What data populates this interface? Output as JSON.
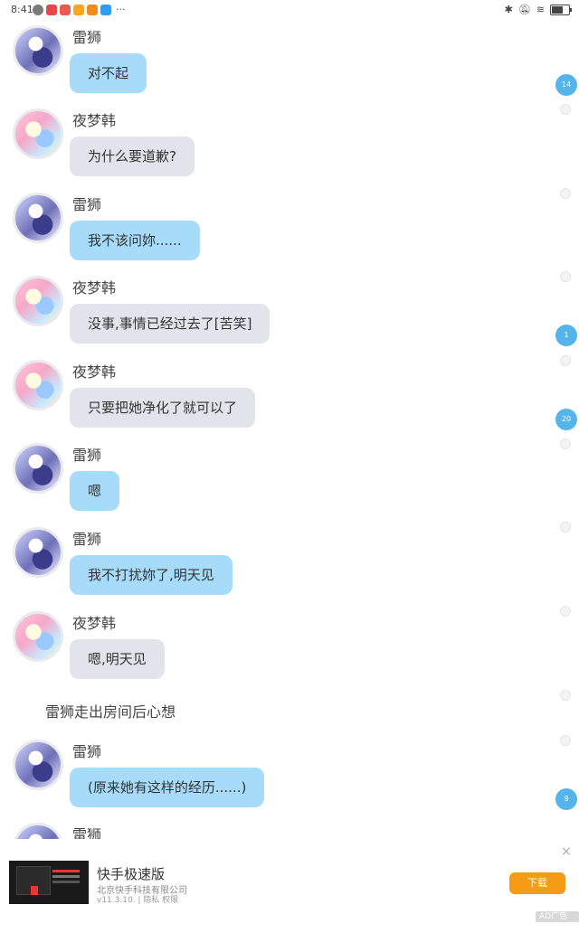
{
  "status_bar": {
    "time": "8:41",
    "overflow": "···",
    "apps": [
      {
        "name": "wechat-icon",
        "color": "#7a7a7a"
      },
      {
        "name": "red-app-icon",
        "color": "#e5484d"
      },
      {
        "name": "red-app-icon-2",
        "color": "#e85a4f"
      },
      {
        "name": "orange-app-icon",
        "color": "#f5a623"
      },
      {
        "name": "orange-app-icon-2",
        "color": "#f08c24"
      },
      {
        "name": "blue-app-icon",
        "color": "#2f9cf0"
      }
    ],
    "right_icons": [
      "bluetooth-icon",
      "mute-icon",
      "wifi-icon",
      "battery-icon"
    ]
  },
  "messages": [
    {
      "speaker": "雷狮",
      "text": "对不起",
      "style": "blue",
      "avatar": "leishi"
    },
    {
      "speaker": "夜梦韩",
      "text": "为什么要道歉?",
      "style": "grey",
      "avatar": "yemeng"
    },
    {
      "speaker": "雷狮",
      "text": "我不该问妳......",
      "style": "blue",
      "avatar": "leishi"
    },
    {
      "speaker": "夜梦韩",
      "text": "没事,事情已经过去了[苦笑]",
      "style": "grey",
      "avatar": "yemeng"
    },
    {
      "speaker": "夜梦韩",
      "text": "只要把她净化了就可以了",
      "style": "grey",
      "avatar": "yemeng"
    },
    {
      "speaker": "雷狮",
      "text": "嗯",
      "style": "blue",
      "avatar": "leishi"
    },
    {
      "speaker": "雷狮",
      "text": "我不打扰妳了,明天见",
      "style": "blue",
      "avatar": "leishi"
    },
    {
      "speaker": "夜梦韩",
      "text": "嗯,明天见",
      "style": "grey",
      "avatar": "yemeng"
    },
    {
      "speaker": "雷狮",
      "text": "(原来她有这样的经历......)",
      "style": "blue",
      "avatar": "leishi"
    },
    {
      "speaker": "雷狮",
      "text": "",
      "style": "blue",
      "avatar": "leishi"
    }
  ],
  "narration": "雷狮走出房间后心想",
  "comment_badges": [
    "14",
    "1",
    "20",
    "9"
  ],
  "ad": {
    "title": "快手极速版",
    "company": "北京快手科技有限公司",
    "meta": "v11.3.10. | 隐私  权限",
    "download_label": "下载",
    "close_label": "×",
    "tag_label": "AD广告 ⌄"
  }
}
